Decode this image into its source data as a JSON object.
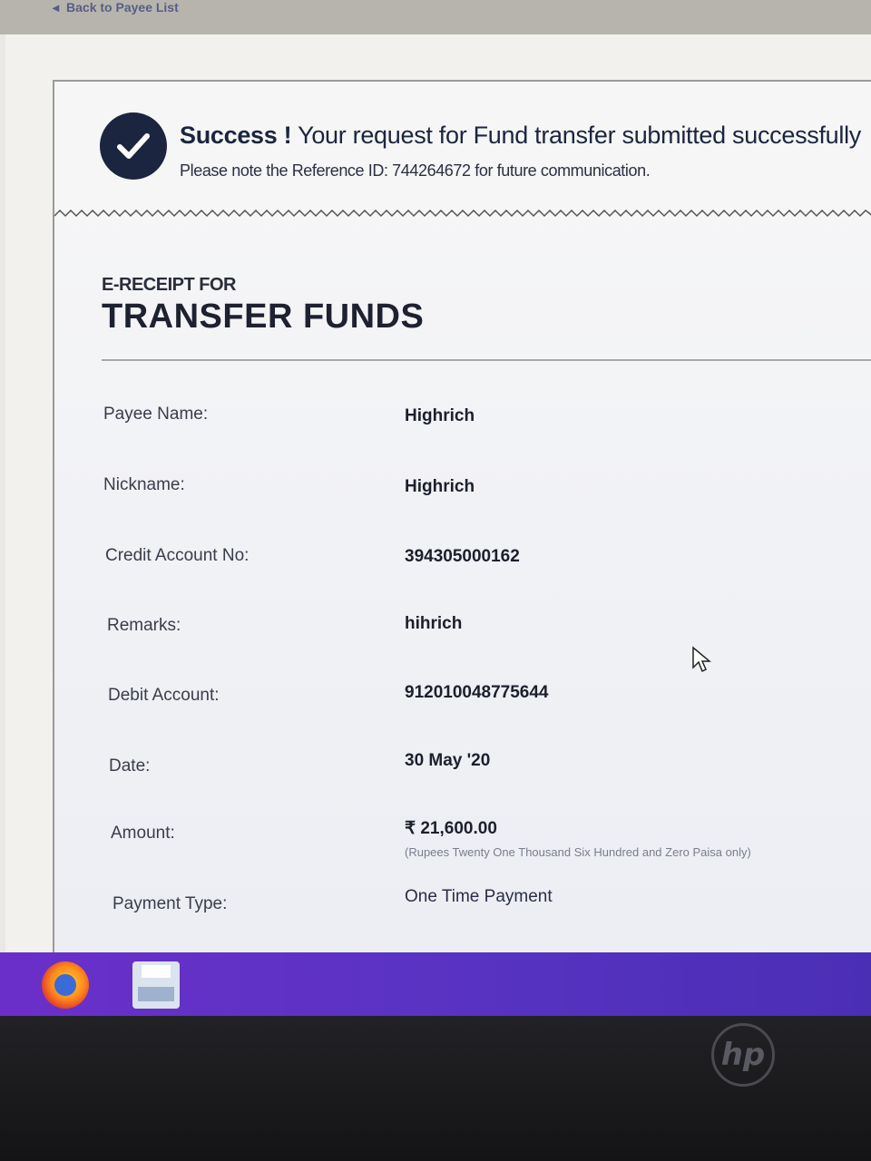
{
  "topbar": {
    "back_link": "Back to Payee List"
  },
  "success": {
    "title_bold": "Success !",
    "title_rest": " Your request for Fund transfer submitted successfully",
    "subtitle": "Please note the Reference ID: 744264672 for future communication."
  },
  "receipt": {
    "label": "E-RECEIPT FOR",
    "title": "TRANSFER FUNDS",
    "rows": [
      {
        "label": "Payee Name:",
        "value": "Highrich"
      },
      {
        "label": "Nickname:",
        "value": "Highrich"
      },
      {
        "label": "Credit Account No:",
        "value": "394305000162"
      },
      {
        "label": "Remarks:",
        "value": "hihrich"
      },
      {
        "label": "Debit Account:",
        "value": "912010048775644"
      },
      {
        "label": "Date:",
        "value": "30 May '20"
      },
      {
        "label": "Amount:",
        "value": "₹ 21,600.00",
        "words": "(Rupees Twenty One Thousand Six Hundred and Zero Paisa only)"
      },
      {
        "label": "Payment Type:",
        "value": "One Time Payment"
      }
    ]
  },
  "taskbar": {
    "icons": [
      "firefox-icon",
      "printer-icon"
    ]
  },
  "bezel": {
    "logo": "hp"
  },
  "colors": {
    "accent": "#1b2540",
    "taskbar": "#5b33c4"
  }
}
